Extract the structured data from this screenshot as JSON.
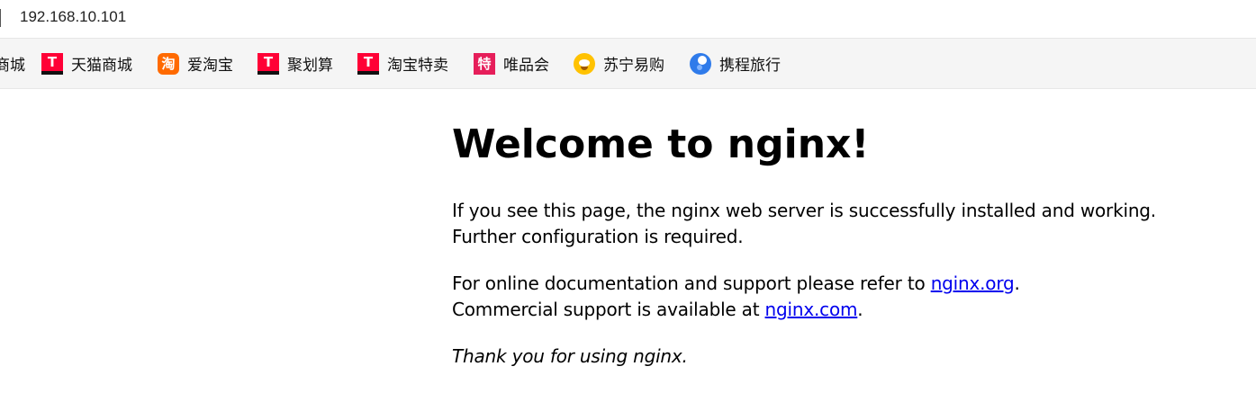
{
  "address_bar": {
    "url": "192.168.10.101"
  },
  "bookmarks": [
    {
      "label": "商城",
      "icon": "none"
    },
    {
      "label": "天猫商城",
      "icon": "tmall-icon",
      "glyph": "T"
    },
    {
      "label": "爱淘宝",
      "icon": "taobao-icon",
      "glyph": "淘"
    },
    {
      "label": "聚划算",
      "icon": "juhuasuan-icon",
      "glyph": "T"
    },
    {
      "label": "淘宝特卖",
      "icon": "taobao-temai-icon",
      "glyph": "T"
    },
    {
      "label": "唯品会",
      "icon": "vipshop-icon",
      "glyph": "特"
    },
    {
      "label": "苏宁易购",
      "icon": "suning-icon",
      "glyph": ""
    },
    {
      "label": "携程旅行",
      "icon": "ctrip-icon",
      "glyph": ""
    }
  ],
  "page": {
    "heading": "Welcome to nginx!",
    "para1": "If you see this page, the nginx web server is successfully installed and working. Further configuration is required.",
    "para2_prefix": "For online documentation and support please refer to ",
    "link_org": "nginx.org",
    "para2_mid": ".",
    "para2_line2": "Commercial support is available at ",
    "link_com": "nginx.com",
    "para2_end": ".",
    "thanks": "Thank you for using nginx."
  },
  "colors": {
    "link": "#0000ee",
    "tmall_red": "#ff0036",
    "taobao_orange": "#ff6a00",
    "vip_pink": "#e61e5a",
    "suning_yellow": "#ffc200",
    "ctrip_blue": "#2f7bea"
  }
}
